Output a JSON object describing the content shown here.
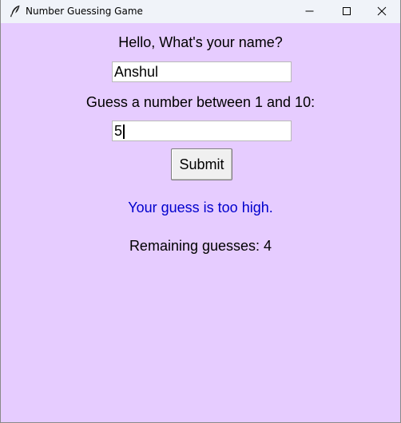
{
  "window": {
    "title": "Number Guessing Game",
    "icon": "feather-icon",
    "controls": [
      "minimize-icon",
      "maximize-icon",
      "close-icon"
    ],
    "background": "#e6ccff"
  },
  "form": {
    "name_label": "Hello, What's your name?",
    "name_value": "Anshul",
    "guess_label": "Guess a number between 1 and 10:",
    "guess_value": "5",
    "submit_label": "Submit"
  },
  "status": {
    "result_text": "Your guess is too high.",
    "result_color": "#0000cd",
    "remaining_text": "Remaining guesses: 4"
  }
}
